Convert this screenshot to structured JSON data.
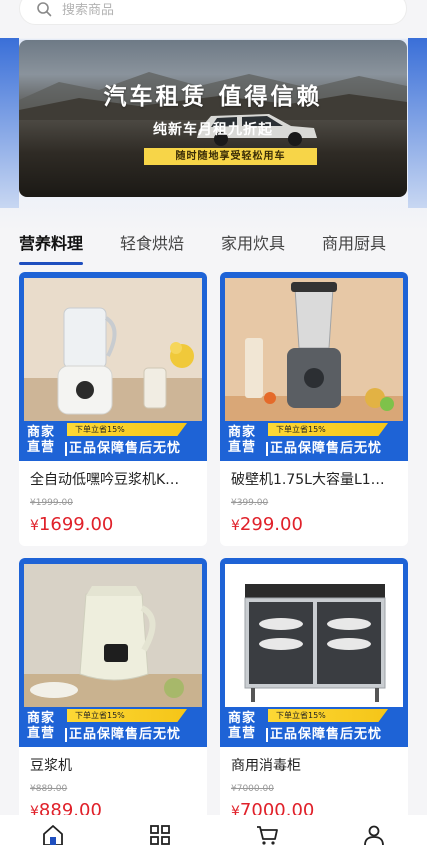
{
  "search": {
    "placeholder": "搜索商品"
  },
  "banner": {
    "title": "汽车租赁 值得信赖",
    "subtitle": "纯新车月租九折起",
    "tag": "随时随地享受轻松用车"
  },
  "tabs": [
    {
      "label": "营养料理",
      "active": true
    },
    {
      "label": "轻食烘焙",
      "active": false
    },
    {
      "label": "家用炊具",
      "active": false
    },
    {
      "label": "商用厨具",
      "active": false
    }
  ],
  "badges": {
    "merchant_line1": "商家",
    "merchant_line2": "直营",
    "discount": "下单立省15%",
    "guarantee": "正品保障售后无忧"
  },
  "products": [
    {
      "name": "全自动低嘿吟豆浆机K…",
      "original_price": "¥1999.00",
      "currency": "¥",
      "price": "1699.00",
      "image_icon": "soymilk-maker-icon"
    },
    {
      "name": "破壁机1.75L大容量L1…",
      "original_price": "¥399.00",
      "currency": "¥",
      "price": "299.00",
      "image_icon": "blender-icon"
    },
    {
      "name": "豆浆机",
      "original_price": "¥889.00",
      "currency": "¥",
      "price": "889.00",
      "image_icon": "soymilk-maker-icon"
    },
    {
      "name": "商用消毒柜",
      "original_price": "¥7000.00",
      "currency": "¥",
      "price": "7000.00",
      "image_icon": "disinfection-cabinet-icon"
    }
  ],
  "bottom_nav": [
    {
      "icon": "home-icon"
    },
    {
      "icon": "category-icon"
    },
    {
      "icon": "cart-icon"
    },
    {
      "icon": "profile-icon"
    }
  ],
  "colors": {
    "accent": "#1f4fbf",
    "price": "#e0212a",
    "badge_blue": "#1e63d6",
    "badge_yellow": "#fdd835"
  }
}
